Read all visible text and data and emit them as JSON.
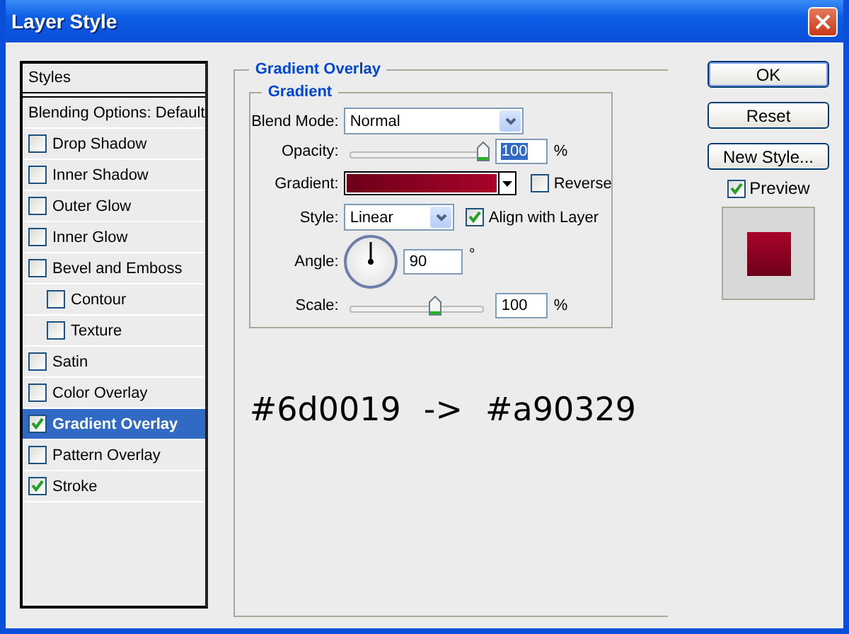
{
  "window": {
    "title": "Layer Style"
  },
  "styles_list": {
    "header": "Styles",
    "items": [
      {
        "kind": "plain",
        "label": "Blending Options: Default",
        "selected": false
      },
      {
        "kind": "checkbox",
        "label": "Drop Shadow",
        "checked": false,
        "selected": false
      },
      {
        "kind": "checkbox",
        "label": "Inner Shadow",
        "checked": false,
        "selected": false
      },
      {
        "kind": "checkbox",
        "label": "Outer Glow",
        "checked": false,
        "selected": false
      },
      {
        "kind": "checkbox",
        "label": "Inner Glow",
        "checked": false,
        "selected": false
      },
      {
        "kind": "checkbox",
        "label": "Bevel and Emboss",
        "checked": false,
        "selected": false,
        "children": [
          {
            "kind": "checkbox",
            "label": "Contour",
            "checked": false,
            "selected": false
          },
          {
            "kind": "checkbox",
            "label": "Texture",
            "checked": false,
            "selected": false
          }
        ]
      },
      {
        "kind": "checkbox",
        "label": "Satin",
        "checked": false,
        "selected": false
      },
      {
        "kind": "checkbox",
        "label": "Color Overlay",
        "checked": false,
        "selected": false
      },
      {
        "kind": "checkbox",
        "label": "Gradient Overlay",
        "checked": true,
        "selected": true
      },
      {
        "kind": "checkbox",
        "label": "Pattern Overlay",
        "checked": false,
        "selected": false
      },
      {
        "kind": "checkbox",
        "label": "Stroke",
        "checked": true,
        "selected": false
      }
    ]
  },
  "panel": {
    "title": "Gradient Overlay",
    "group": {
      "title": "Gradient",
      "blend_mode": {
        "label": "Blend Mode:",
        "value": "Normal"
      },
      "opacity": {
        "label": "Opacity:",
        "level": 1,
        "value": "100",
        "value_selected": true,
        "unit": "%"
      },
      "gradient": {
        "label": "Gradient:"
      },
      "reverse": {
        "label": "Reverse",
        "checked": false
      },
      "style": {
        "label": "Style:",
        "value": "Linear"
      },
      "align": {
        "label": "Align with Layer",
        "checked": true
      },
      "angle": {
        "label": "Angle:",
        "value": "90",
        "unit": "°"
      },
      "scale": {
        "label": "Scale:",
        "level": 0.64,
        "value": "100",
        "value_selected": false,
        "unit": "%"
      }
    },
    "note": {
      "from": "#6d0019",
      "arrow": "->",
      "to": "#a90329"
    }
  },
  "buttons": [
    {
      "label": "OK",
      "default": true
    },
    {
      "label": "Reset",
      "default": false
    },
    {
      "label": "New Style...",
      "default": false
    }
  ],
  "preview": {
    "label": "Preview",
    "checked": true
  }
}
